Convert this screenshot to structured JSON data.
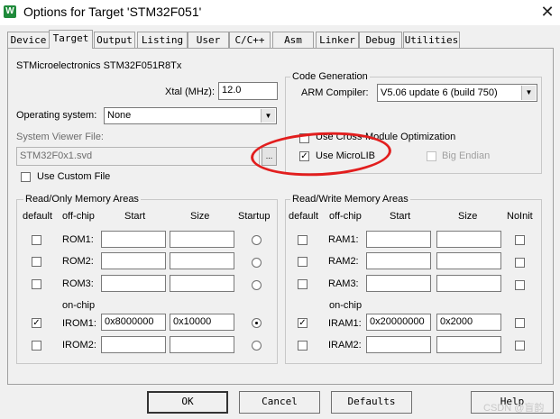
{
  "window": {
    "title": "Options for Target 'STM32F051'",
    "logo_text": "W",
    "close_label": "✕"
  },
  "tabs": [
    {
      "label": "Device"
    },
    {
      "label": "Target"
    },
    {
      "label": "Output"
    },
    {
      "label": "Listing"
    },
    {
      "label": "User"
    },
    {
      "label": "C/C++"
    },
    {
      "label": "Asm"
    },
    {
      "label": "Linker"
    },
    {
      "label": "Debug"
    },
    {
      "label": "Utilities"
    }
  ],
  "active_tab": "Target",
  "device_name": "STMicroelectronics STM32F051R8Tx",
  "xtal": {
    "label": "Xtal (MHz):",
    "value": "12.0"
  },
  "os": {
    "label": "Operating system:",
    "value": "None"
  },
  "svd": {
    "label": "System Viewer File:",
    "value": "STM32F0x1.svd",
    "browse": "..."
  },
  "custom_file": {
    "label": "Use Custom File",
    "checked": false
  },
  "codegen": {
    "title": "Code Generation",
    "compiler_label": "ARM Compiler:",
    "compiler_value": "V5.06 update 6 (build 750)",
    "cross_module": {
      "label": "Use Cross-Module Optimization",
      "checked": false
    },
    "microlib": {
      "label": "Use MicroLIB",
      "checked": true
    },
    "big_endian": {
      "label": "Big Endian",
      "checked": false,
      "disabled": true
    }
  },
  "ro": {
    "title": "Read/Only Memory Areas",
    "headers": {
      "default": "default",
      "offchip": "off-chip",
      "start": "Start",
      "size": "Size",
      "startup": "Startup"
    },
    "onchip_label": "on-chip",
    "rows": [
      {
        "name": "ROM1:",
        "default": false,
        "start": "",
        "size": "",
        "startup": false
      },
      {
        "name": "ROM2:",
        "default": false,
        "start": "",
        "size": "",
        "startup": false
      },
      {
        "name": "ROM3:",
        "default": false,
        "start": "",
        "size": "",
        "startup": false
      },
      {
        "name": "IROM1:",
        "default": true,
        "start": "0x8000000",
        "size": "0x10000",
        "startup": true
      },
      {
        "name": "IROM2:",
        "default": false,
        "start": "",
        "size": "",
        "startup": false
      }
    ]
  },
  "rw": {
    "title": "Read/Write Memory Areas",
    "headers": {
      "default": "default",
      "offchip": "off-chip",
      "start": "Start",
      "size": "Size",
      "noinit": "NoInit"
    },
    "onchip_label": "on-chip",
    "rows": [
      {
        "name": "RAM1:",
        "default": false,
        "start": "",
        "size": "",
        "noinit": false
      },
      {
        "name": "RAM2:",
        "default": false,
        "start": "",
        "size": "",
        "noinit": false
      },
      {
        "name": "RAM3:",
        "default": false,
        "start": "",
        "size": "",
        "noinit": false
      },
      {
        "name": "IRAM1:",
        "default": true,
        "start": "0x20000000",
        "size": "0x2000",
        "noinit": false
      },
      {
        "name": "IRAM2:",
        "default": false,
        "start": "",
        "size": "",
        "noinit": false
      }
    ]
  },
  "buttons": {
    "ok": "OK",
    "cancel": "Cancel",
    "defaults": "Defaults",
    "help": "Help"
  },
  "watermark": "CSDN @盲韵",
  "colors": {
    "annotation_circle": "#e21e1e",
    "logo_bg": "#1f8a3b"
  }
}
